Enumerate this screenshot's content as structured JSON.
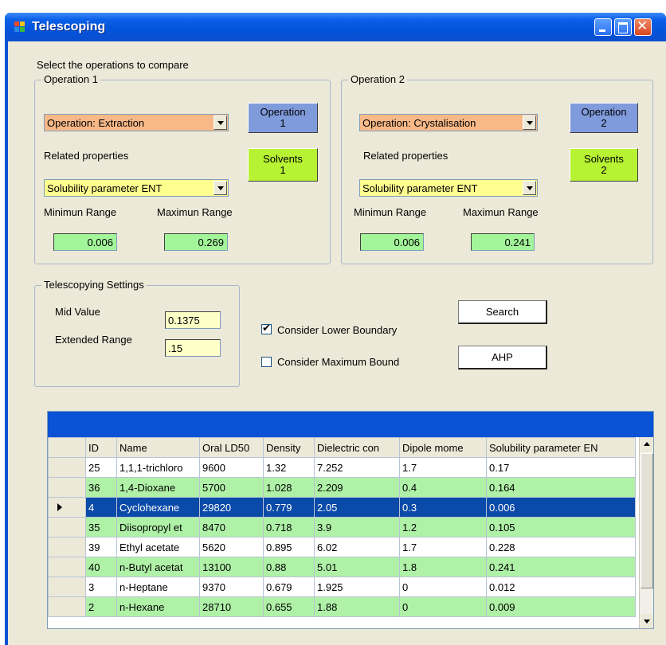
{
  "window": {
    "title": "Telescoping"
  },
  "header": {
    "instruction": "Select the operations to compare"
  },
  "operation1": {
    "legend": "Operation 1",
    "operation_select": "Operation: Extraction",
    "operation_button": [
      "Operation",
      "1"
    ],
    "related_label": "Related properties",
    "solvents_button": [
      "Solvents",
      "1"
    ],
    "property_select": "Solubility parameter ENT",
    "min_label": "Minimun Range",
    "max_label": "Maximun Range",
    "min_value": "0.006",
    "max_value": "0.269"
  },
  "operation2": {
    "legend": "Operation 2",
    "operation_select": "Operation: Crystalisation",
    "operation_button": [
      "Operation",
      "2"
    ],
    "related_label": "Related properties",
    "solvents_button": [
      "Solvents",
      "2"
    ],
    "property_select": "Solubility parameter ENT",
    "min_label": "Minimun Range",
    "max_label": "Maximun Range",
    "min_value": "0.006",
    "max_value": "0.241"
  },
  "settings": {
    "legend": "Telescopying Settings",
    "mid_label": "Mid Value",
    "mid_value": "0.1375",
    "ext_label": "Extended Range",
    "ext_value": ".15"
  },
  "options": {
    "lower_label": "Consider Lower Boundary",
    "lower_checked": true,
    "max_label": "Consider  Maximum Bound",
    "max_checked": false
  },
  "buttons": {
    "search": "Search",
    "ahp": "AHP"
  },
  "grid": {
    "columns": [
      "ID",
      "Name",
      "Oral LD50",
      "Density",
      "Dielectric con",
      "Dipole mome",
      "Solubility parameter EN"
    ],
    "selected_row": 2,
    "rows": [
      [
        "25",
        "1,1,1-trichloro",
        "9600",
        "1.32",
        "7.252",
        "1.7",
        "0.17"
      ],
      [
        "36",
        "1,4-Dioxane",
        "5700",
        "1.028",
        "2.209",
        "0.4",
        "0.164"
      ],
      [
        "4",
        "Cyclohexane",
        "29820",
        "0.779",
        "2.05",
        "0.3",
        "0.006"
      ],
      [
        "35",
        "Diisopropyl et",
        "8470",
        "0.718",
        "3.9",
        "1.2",
        "0.105"
      ],
      [
        "39",
        "Ethyl acetate",
        "5620",
        "0.895",
        "6.02",
        "1.7",
        "0.228"
      ],
      [
        "40",
        "n-Butyl acetat",
        "13100",
        "0.88",
        "5.01",
        "1.8",
        "0.241"
      ],
      [
        "3",
        "n-Heptane",
        "9370",
        "0.679",
        "1.925",
        "0",
        "0.012"
      ],
      [
        "2",
        "n-Hexane",
        "28710",
        "0.655",
        "1.88",
        "0",
        "0.009"
      ]
    ]
  },
  "colors": {
    "operation_select_bg": "#f7b987",
    "property_select_bg": "#ffff90",
    "operation_button_bg": "#7f9bdc",
    "solvents_button_bg": "#b7f233",
    "range_field_bg": "#a3f59a",
    "settings_field_bg": "#ffffc8",
    "row_alt_bg": "#aff1a7",
    "row_selected_bg": "#0a4aa8"
  }
}
